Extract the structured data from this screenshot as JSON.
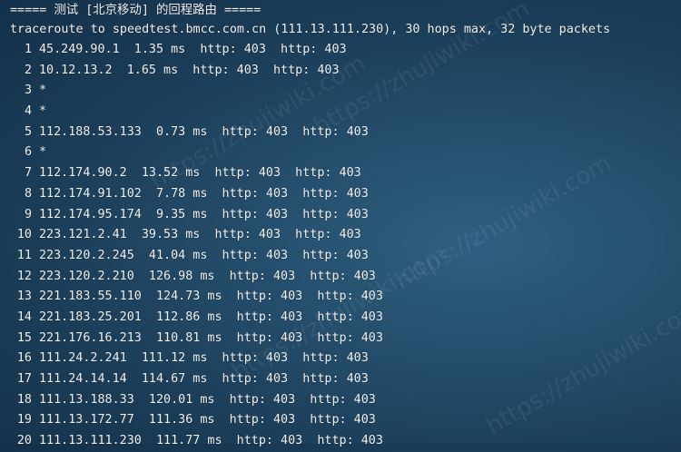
{
  "terminal": {
    "header": "===== 测试 [北京移动] 的回程路由 =====",
    "command": "traceroute to speedtest.bmcc.com.cn (111.13.111.230), 30 hops max, 32 byte packets",
    "hops": [
      {
        "n": "1",
        "text": "45.249.90.1  1.35 ms  http: 403  http: 403"
      },
      {
        "n": "2",
        "text": "10.12.13.2  1.65 ms  http: 403  http: 403"
      },
      {
        "n": "3",
        "text": "*"
      },
      {
        "n": "4",
        "text": "*"
      },
      {
        "n": "5",
        "text": "112.188.53.133  0.73 ms  http: 403  http: 403"
      },
      {
        "n": "6",
        "text": "*"
      },
      {
        "n": "7",
        "text": "112.174.90.2  13.52 ms  http: 403  http: 403"
      },
      {
        "n": "8",
        "text": "112.174.91.102  7.78 ms  http: 403  http: 403"
      },
      {
        "n": "9",
        "text": "112.174.95.174  9.35 ms  http: 403  http: 403"
      },
      {
        "n": "10",
        "text": "223.121.2.41  39.53 ms  http: 403  http: 403"
      },
      {
        "n": "11",
        "text": "223.120.2.245  41.04 ms  http: 403  http: 403"
      },
      {
        "n": "12",
        "text": "223.120.2.210  126.98 ms  http: 403  http: 403"
      },
      {
        "n": "13",
        "text": "221.183.55.110  124.73 ms  http: 403  http: 403"
      },
      {
        "n": "14",
        "text": "221.183.25.201  112.86 ms  http: 403  http: 403"
      },
      {
        "n": "15",
        "text": "221.176.16.213  110.81 ms  http: 403  http: 403"
      },
      {
        "n": "16",
        "text": "111.24.2.241  111.12 ms  http: 403  http: 403"
      },
      {
        "n": "17",
        "text": "111.24.14.14  114.67 ms  http: 403  http: 403"
      },
      {
        "n": "18",
        "text": "111.13.188.33  120.01 ms  http: 403  http: 403"
      },
      {
        "n": "19",
        "text": "111.13.172.77  111.36 ms  http: 403  http: 403"
      },
      {
        "n": "20",
        "text": "111.13.111.230  111.77 ms  http: 403  http: 403"
      }
    ]
  },
  "watermark": {
    "text": "https://zhujiwiki.com"
  }
}
